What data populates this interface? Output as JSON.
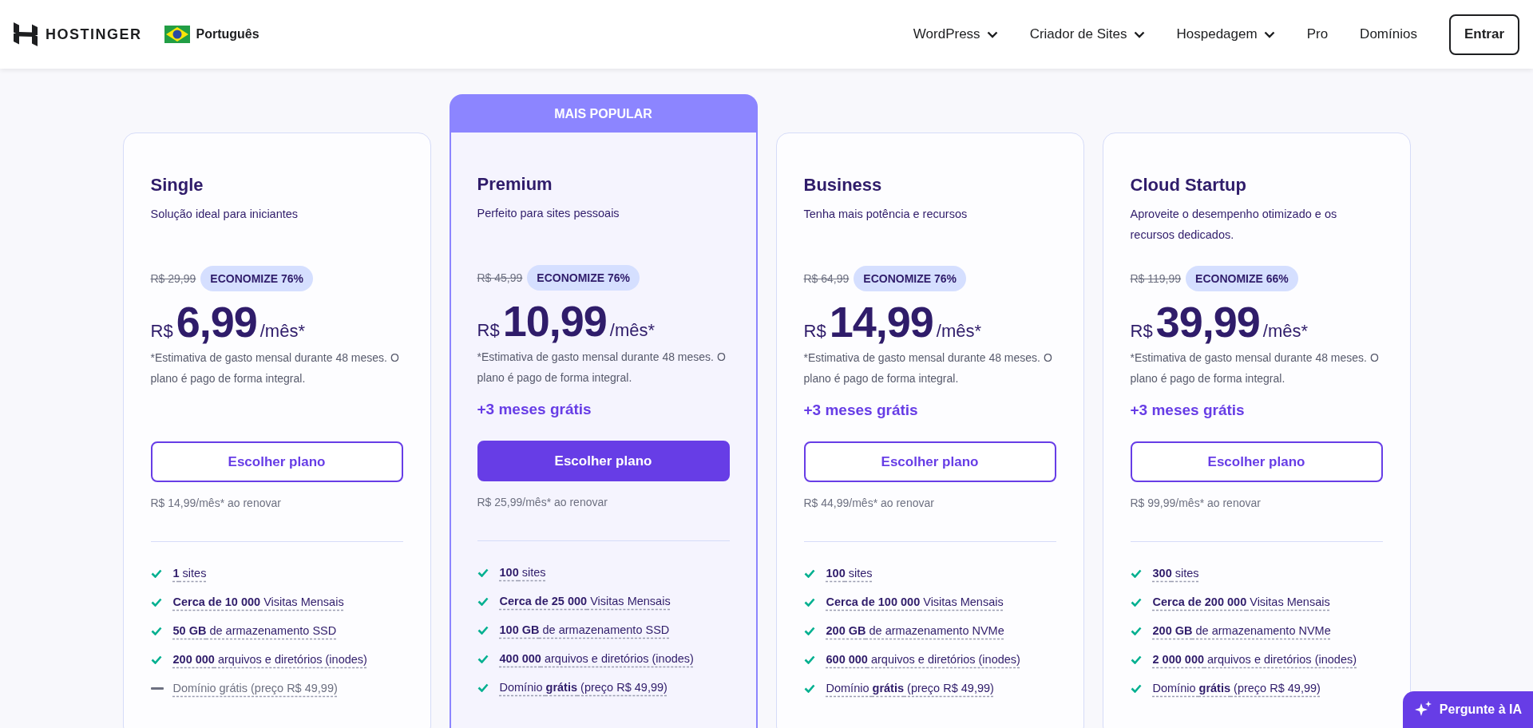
{
  "header": {
    "brand": "HOSTINGER",
    "language": "Português",
    "nav": [
      {
        "label": "WordPress",
        "dropdown": true
      },
      {
        "label": "Criador de Sites",
        "dropdown": true
      },
      {
        "label": "Hospedagem",
        "dropdown": true
      },
      {
        "label": "Pro",
        "dropdown": false
      },
      {
        "label": "Domínios",
        "dropdown": false
      }
    ],
    "login": "Entrar"
  },
  "plans": [
    {
      "featured": false,
      "name": "Single",
      "description": "Solução ideal para iniciantes",
      "old_price": "R$ 29,99",
      "discount": "ECONOMIZE 76%",
      "currency": "R$",
      "amount": "6,99",
      "period": "/mês*",
      "note": "*Estimativa de gasto mensal durante 48 meses. O plano é pago de forma integral.",
      "button": "Escolher plano",
      "renewal": "R$ 14,99/mês* ao renovar",
      "features": [
        {
          "kind": "included",
          "text": "**1** sites"
        },
        {
          "kind": "included",
          "text": "**Cerca de 10 000** Visitas Mensais"
        },
        {
          "kind": "included",
          "text": "**50 GB** de armazenamento SSD"
        },
        {
          "kind": "included",
          "text": "**200 000** arquivos e diretórios (inodes)"
        },
        {
          "kind": "excluded",
          "text": "Domínio grátis (preço R$ 49,99)"
        }
      ]
    },
    {
      "featured": true,
      "badge": "MAIS POPULAR",
      "name": "Premium",
      "description": "Perfeito para sites pessoais",
      "old_price": "R$ 45,99",
      "discount": "ECONOMIZE 76%",
      "currency": "R$",
      "amount": "10,99",
      "period": "/mês*",
      "note": "*Estimativa de gasto mensal durante 48 meses. O plano é pago de forma integral.",
      "bonus": "+3 meses grátis",
      "button": "Escolher plano",
      "renewal": "R$ 25,99/mês* ao renovar",
      "features": [
        {
          "kind": "included",
          "text": "**100** sites"
        },
        {
          "kind": "included",
          "text": "**Cerca de 25 000** Visitas Mensais"
        },
        {
          "kind": "included",
          "text": "**100 GB** de armazenamento SSD"
        },
        {
          "kind": "included",
          "text": "**400 000** arquivos e diretórios (inodes)"
        },
        {
          "kind": "included",
          "text": "Domínio **grátis** (preço R$ 49,99)"
        }
      ]
    },
    {
      "featured": false,
      "name": "Business",
      "description": "Tenha mais potência e recursos",
      "old_price": "R$ 64,99",
      "discount": "ECONOMIZE 76%",
      "currency": "R$",
      "amount": "14,99",
      "period": "/mês*",
      "note": "*Estimativa de gasto mensal durante 48 meses. O plano é pago de forma integral.",
      "bonus": "+3 meses grátis",
      "button": "Escolher plano",
      "renewal": "R$ 44,99/mês* ao renovar",
      "features": [
        {
          "kind": "included",
          "text": "**100** sites"
        },
        {
          "kind": "included",
          "text": "**Cerca de 100 000** Visitas Mensais"
        },
        {
          "kind": "included",
          "text": "**200 GB** de armazenamento NVMe"
        },
        {
          "kind": "included",
          "text": "**600 000** arquivos e diretórios (inodes)"
        },
        {
          "kind": "included",
          "text": "Domínio **grátis** (preço R$ 49,99)"
        }
      ]
    },
    {
      "featured": false,
      "name": "Cloud Startup",
      "description": "Aproveite o desempenho otimizado e os recursos dedicados.",
      "old_price": "R$ 119,99",
      "discount": "ECONOMIZE 66%",
      "currency": "R$",
      "amount": "39,99",
      "period": "/mês*",
      "note": "*Estimativa de gasto mensal durante 48 meses. O plano é pago de forma integral.",
      "bonus": "+3 meses grátis",
      "button": "Escolher plano",
      "renewal": "R$ 99,99/mês* ao renovar",
      "features": [
        {
          "kind": "included",
          "text": "**300** sites"
        },
        {
          "kind": "included",
          "text": "**Cerca de 200 000** Visitas Mensais"
        },
        {
          "kind": "included",
          "text": "**200 GB** de armazenamento NVMe"
        },
        {
          "kind": "included",
          "text": "**2 000 000** arquivos e diretórios (inodes)"
        },
        {
          "kind": "included",
          "text": "Domínio **grátis** (preço R$ 49,99)"
        }
      ]
    }
  ],
  "assistant": {
    "label": "Pergunte à IA"
  }
}
